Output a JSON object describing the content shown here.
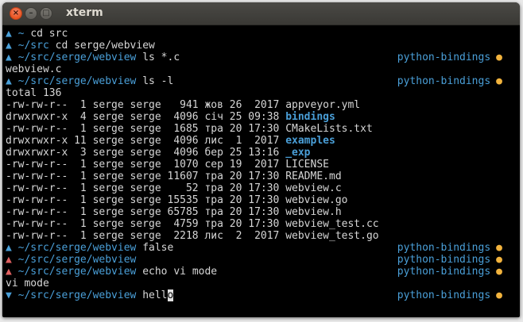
{
  "window": {
    "title": "xterm",
    "controls": {
      "close": "×",
      "minimize": "–",
      "maximize": "□"
    }
  },
  "symbols": {
    "arrow_up": "▲",
    "arrow_down": "▼",
    "dot": "●"
  },
  "colors": {
    "prompt_blue": "#4a9fd8",
    "prompt_red": "#e06060",
    "dot_yellow": "#f2b33d",
    "background": "#000000"
  },
  "terminal": {
    "l1": {
      "path": "~",
      "cmd": "cd src"
    },
    "l2": {
      "path": "~/src",
      "cmd": "cd serge/webview"
    },
    "l3": {
      "path": "~/src/serge/webview",
      "cmd": "ls *.c",
      "branch": "python-bindings"
    },
    "l4": {
      "text": "webview.c"
    },
    "l5": {
      "path": "~/src/serge/webview",
      "cmd": "ls -l",
      "branch": "python-bindings"
    },
    "l6": {
      "text": "total 136"
    },
    "listing": [
      {
        "meta": "-rw-rw-r--  1 serge serge   941 жов 26  2017 ",
        "name": "appveyor.yml",
        "dir": false
      },
      {
        "meta": "drwxrwxr-x  4 serge serge  4096 січ 25 09:38 ",
        "name": "bindings",
        "dir": true
      },
      {
        "meta": "-rw-rw-r--  1 serge serge  1685 тра 20 17:30 ",
        "name": "CMakeLists.txt",
        "dir": false
      },
      {
        "meta": "drwxrwxr-x 11 serge serge  4096 лис  1  2017 ",
        "name": "examples",
        "dir": true
      },
      {
        "meta": "drwxrwxr-x  3 serge serge  4096 бер 25 13:16 ",
        "name": "_exp",
        "dir": true
      },
      {
        "meta": "-rw-rw-r--  1 serge serge  1070 сер 19  2017 ",
        "name": "LICENSE",
        "dir": false
      },
      {
        "meta": "-rw-rw-r--  1 serge serge 11607 тра 20 17:30 ",
        "name": "README.md",
        "dir": false
      },
      {
        "meta": "-rw-rw-r--  1 serge serge    52 тра 20 17:30 ",
        "name": "webview.c",
        "dir": false
      },
      {
        "meta": "-rw-rw-r--  1 serge serge 15535 тра 20 17:30 ",
        "name": "webview.go",
        "dir": false
      },
      {
        "meta": "-rw-rw-r--  1 serge serge 65785 тра 20 17:30 ",
        "name": "webview.h",
        "dir": false
      },
      {
        "meta": "-rw-rw-r--  1 serge serge  4759 тра 20 17:30 ",
        "name": "webview_test.cc",
        "dir": false
      },
      {
        "meta": "-rw-rw-r--  1 serge serge  2218 лис  2  2017 ",
        "name": "webview_test.go",
        "dir": false
      }
    ],
    "l20": {
      "path": "~/src/serge/webview",
      "cmd": "false",
      "branch": "python-bindings"
    },
    "l21": {
      "path": "~/src/serge/webview",
      "branch": "python-bindings"
    },
    "l22": {
      "path": "~/src/serge/webview",
      "cmd": "echo vi mode",
      "branch": "python-bindings"
    },
    "l23": {
      "text": "vi mode"
    },
    "l24": {
      "path": "~/src/serge/webview",
      "cmd_before_cursor": "hell",
      "cursor_char": "o",
      "branch": "python-bindings"
    }
  }
}
